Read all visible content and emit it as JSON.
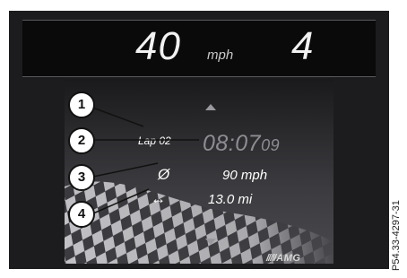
{
  "speed_bar": {
    "speed": "40",
    "unit": "mph",
    "gear": "4"
  },
  "race_timer": {
    "lap_label": "Lap 02",
    "lap_time_main": "08:07",
    "lap_time_hundredths": "09",
    "avg_speed_symbol": "Ø",
    "avg_speed": "90 mph",
    "distance_symbol": "↔",
    "distance": "13.0 mi"
  },
  "branding": {
    "logo_stripes": "/////",
    "logo_text": "AMG"
  },
  "callouts": [
    "1",
    "2",
    "3",
    "4"
  ],
  "figure_code": "P54.33-4297-31",
  "colors": {
    "display_bg": "#1c1c1e",
    "text_primary": "#ffffff",
    "lap_time": "#8e8e92"
  }
}
